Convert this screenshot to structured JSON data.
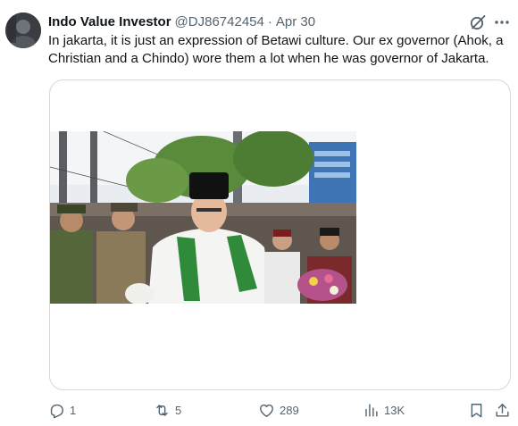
{
  "tweet": {
    "author": {
      "display_name": "Indo Value Investor",
      "handle": "@DJ86742454",
      "separator": "·",
      "date": "Apr 30"
    },
    "text": "In jakarta, it is just an expression of Betawi culture. Our ex governor (Ahok, a Christian and a Chindo) wore them a lot when he was governor of Jakarta.",
    "header_icons": [
      "grok-icon",
      "more-icon"
    ],
    "metrics": {
      "replies": "1",
      "reposts": "5",
      "likes": "289",
      "views": "13K"
    },
    "action_icons": [
      "reply-icon",
      "repost-icon",
      "like-icon",
      "views-icon",
      "bookmark-icon",
      "share-icon"
    ],
    "colors": {
      "text": "#0f1419",
      "secondary": "#536471",
      "border": "#cfd9de"
    }
  }
}
